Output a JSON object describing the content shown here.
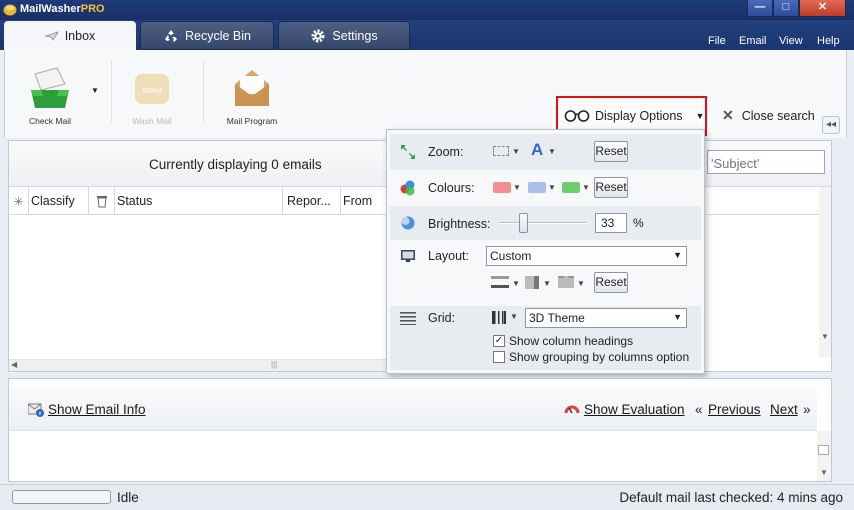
{
  "app": {
    "title_main": "MailWasher",
    "title_suffix": "PRO"
  },
  "window_buttons": {
    "minimize": "—",
    "maximize": "□",
    "close": "✕"
  },
  "tabs": [
    {
      "label": "Inbox",
      "icon": "inbox-icon",
      "active": true
    },
    {
      "label": "Recycle Bin",
      "icon": "recycle-icon",
      "active": false
    },
    {
      "label": "Settings",
      "icon": "gear-icon",
      "active": false
    }
  ],
  "menu": [
    "File",
    "Email",
    "View",
    "Help"
  ],
  "toolbar": {
    "check_mail": "Check Mail",
    "wash_mail": "Wash Mail",
    "mail_program": "Mail Program",
    "display_options": "Display Options",
    "close_search": "Close search",
    "collapse": "◂◂"
  },
  "main": {
    "displaying": "Currently displaying 0 emails",
    "search_value": "'Subject'",
    "columns": [
      "Classify",
      "Status",
      "Repor...",
      "From"
    ]
  },
  "display_options": {
    "zoom_label": "Zoom:",
    "colours_label": "Colours:",
    "brightness_label": "Brightness:",
    "brightness_value": "33",
    "brightness_unit": "%",
    "brightness_level": 0.33,
    "layout_label": "Layout:",
    "layout_value": "Custom",
    "grid_label": "Grid:",
    "grid_value": "3D Theme",
    "reset": "Reset",
    "font_glyph": "A",
    "show_column_headings": "Show column headings",
    "show_column_headings_checked": true,
    "show_grouping": "Show grouping by columns option",
    "show_grouping_checked": false,
    "colours": {
      "red": "#f28f8f",
      "blue": "#a9bfe8",
      "green": "#6ccf6c"
    }
  },
  "bottom": {
    "show_email_info": "Show Email Info",
    "show_evaluation": "Show Evaluation",
    "previous_prefix": "«",
    "previous": "Previous",
    "next": "Next",
    "next_suffix": "»"
  },
  "status": {
    "state": "Idle",
    "last_checked": "Default mail last checked: 4 mins ago"
  }
}
